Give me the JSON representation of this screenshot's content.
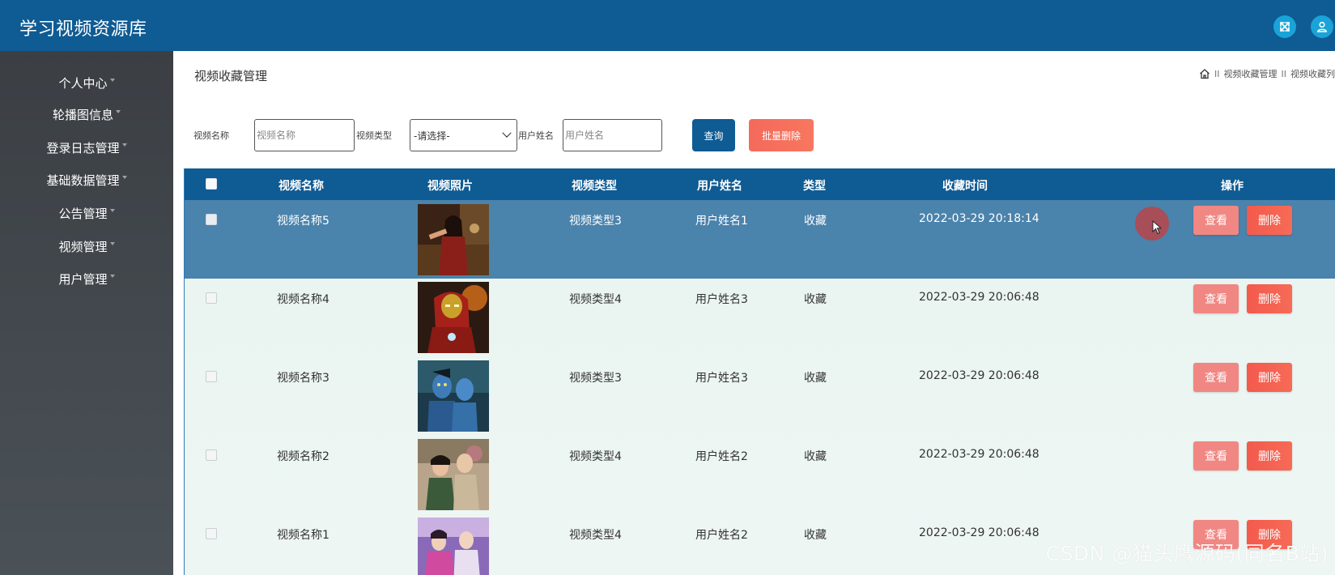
{
  "header": {
    "app_title": "学习视频资源库",
    "icons": [
      "fullscreen-icon",
      "user-icon"
    ],
    "brand_color": "#0f5b93"
  },
  "sidebar": {
    "items": [
      {
        "label": "个人中心"
      },
      {
        "label": "轮播图信息"
      },
      {
        "label": "登录日志管理"
      },
      {
        "label": "基础数据管理"
      },
      {
        "label": "公告管理"
      },
      {
        "label": "视频管理"
      },
      {
        "label": "用户管理"
      }
    ]
  },
  "page": {
    "title": "视频收藏管理",
    "breadcrumb": {
      "separator": "II",
      "items": [
        "视频收藏管理",
        "视频收藏列"
      ]
    }
  },
  "search": {
    "name_label": "视频名称",
    "name_placeholder": "视频名称",
    "type_label": "视频类型",
    "type_selected": "-请选择-",
    "user_label": "用户姓名",
    "user_placeholder": "用户姓名",
    "query_button": "查询",
    "batch_delete_button": "批量删除"
  },
  "table": {
    "headers": {
      "name": "视频名称",
      "photo": "视频照片",
      "type": "视频类型",
      "user": "用户姓名",
      "kind": "类型",
      "time": "收藏时间",
      "actions": "操作"
    },
    "view_label": "查看",
    "delete_label": "删除",
    "rows": [
      {
        "name": "视频名称5",
        "type": "视频类型3",
        "user": "用户姓名1",
        "kind": "收藏",
        "time": "2022-03-29 20:18:14",
        "highlighted": true
      },
      {
        "name": "视频名称4",
        "type": "视频类型4",
        "user": "用户姓名3",
        "kind": "收藏",
        "time": "2022-03-29 20:06:48",
        "highlighted": false
      },
      {
        "name": "视频名称3",
        "type": "视频类型3",
        "user": "用户姓名3",
        "kind": "收藏",
        "time": "2022-03-29 20:06:48",
        "highlighted": false
      },
      {
        "name": "视频名称2",
        "type": "视频类型4",
        "user": "用户姓名2",
        "kind": "收藏",
        "time": "2022-03-29 20:06:48",
        "highlighted": false
      },
      {
        "name": "视频名称1",
        "type": "视频类型4",
        "user": "用户姓名2",
        "kind": "收藏",
        "time": "2022-03-29 20:06:48",
        "highlighted": false
      }
    ]
  },
  "watermark": "CSDN @猫头鹰源码(同名B站)"
}
